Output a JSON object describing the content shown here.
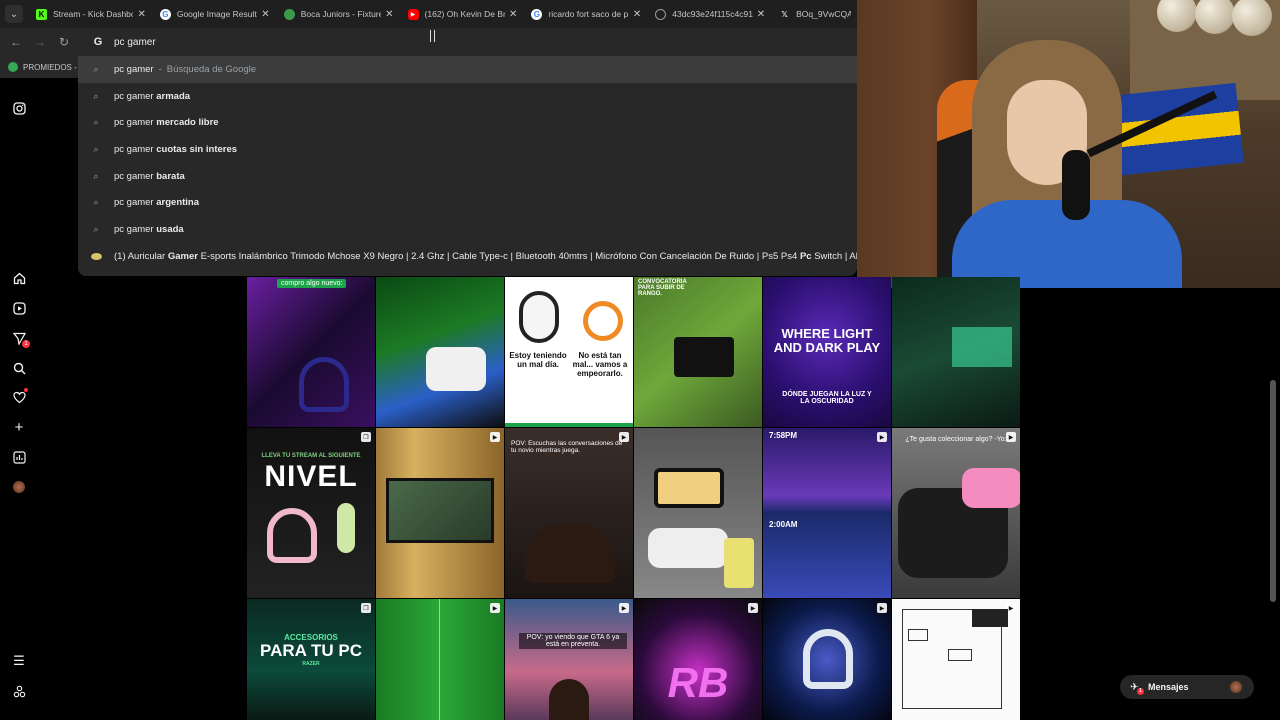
{
  "tabs": [
    {
      "title": "Stream - Kick Dashbo",
      "fav": "K",
      "fav_color": "#53fc18"
    },
    {
      "title": "Google Image Result",
      "fav": "G",
      "fav_color": "#ffffff"
    },
    {
      "title": "Boca Juniors - Fixture",
      "fav": "",
      "fav_color": "#3a9c4a"
    },
    {
      "title": "(162) Oh Kevin De Br",
      "fav": "",
      "fav_color": "#ff0000"
    },
    {
      "title": "ricardo fort saco de p",
      "fav": "G",
      "fav_color": "#ffffff"
    },
    {
      "title": "43dc93e24f115c4c91",
      "fav": "",
      "fav_color": "#777777"
    },
    {
      "title": "BOq_9VwCQAEy7F",
      "fav": "X",
      "fav_color": "#000000"
    }
  ],
  "omnibox": {
    "value": "pc gamer"
  },
  "bookmarks": {
    "item": "PROMIEDOS -"
  },
  "suggestions": [
    {
      "query": "pc gamer",
      "bold": "",
      "sep": "-",
      "sub": "Búsqueda de Google"
    },
    {
      "query": "pc gamer",
      "bold": "armada"
    },
    {
      "query": "pc gamer",
      "bold": "mercado libre"
    },
    {
      "query": "pc gamer",
      "bold": "cuotas sin interes"
    },
    {
      "query": "pc gamer",
      "bold": "barata"
    },
    {
      "query": "pc gamer",
      "bold": "argentina"
    },
    {
      "query": "pc gamer",
      "bold": "usada"
    }
  ],
  "history_suggestion": {
    "prefix": "(1) Auricular ",
    "bold1": "Gamer",
    "mid": " E-sports Inalámbrico Trimodo Mchose X9 Negro | 2.4 Ghz | Cable Type-c | Bluetooth 40mtrs | Micrófono Con Cancelación De Ruido | Ps5 Ps4 ",
    "bold2": "Pc",
    "suffix": " Switch | Almc"
  },
  "leftnav": {
    "notification_badge": "1"
  },
  "tiles": {
    "t1": "compro algo nuevo:",
    "t3a": "Estoy teniendo un mal día.",
    "t3b": "No está tan mal... vamos a empeorarlo.",
    "t4": "CONVOCATORIA PARA SUBIR DE RANGO.",
    "t5a": "WHERE LIGHT AND DARK PLAY",
    "t5b": "DÓNDE JUEGAN LA LUZ Y LA OSCURIDAD",
    "t7a": "LLEVA TU STREAM AL SIGUIENTE",
    "t7b": "NIVEL",
    "t9": "POV: Escuchas las conversaciones de tu novio mientras juega.",
    "t11a": "7:58PM",
    "t11b": "2:00AM",
    "t12": "¿Te gusta coleccionar algo? -Yo:",
    "t13a": "ACCESORIOS",
    "t13b": "PARA TU PC",
    "t13c": "RAZER",
    "t15": "POV: yo viendo que GTA 6 ya está en preventa.",
    "t16": "RB"
  },
  "messages": {
    "label": "Mensajes",
    "badge": "1"
  },
  "colors": {
    "accent_red": "#ff3040",
    "bg": "#000000",
    "dropdown": "#282828"
  }
}
